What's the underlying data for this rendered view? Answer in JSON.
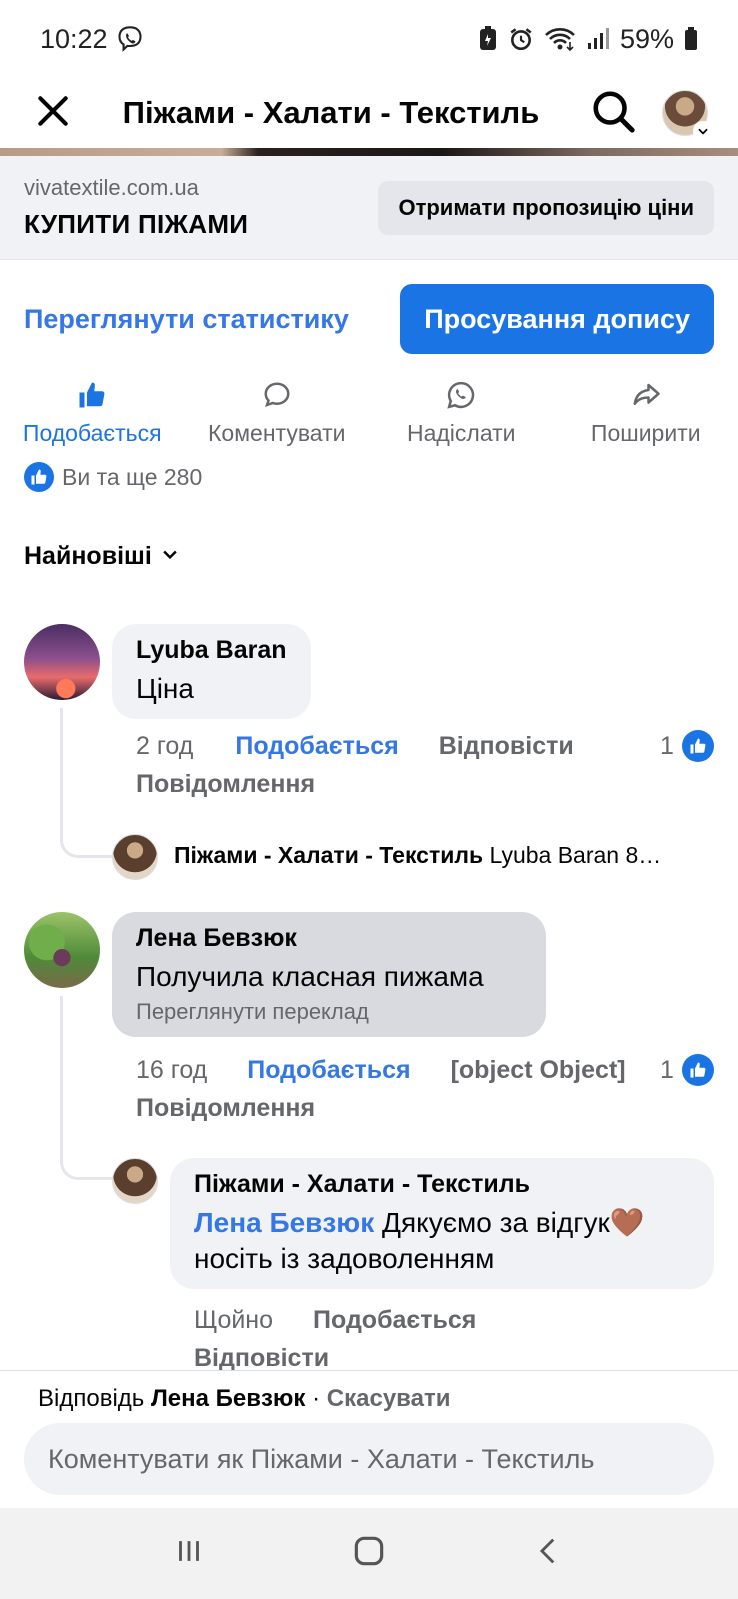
{
  "status_bar": {
    "time": "10:22",
    "battery": "59%"
  },
  "header": {
    "title": "Піжами - Халати - Текстиль"
  },
  "ad": {
    "domain": "vivatextile.com.ua",
    "cta_title": "КУПИТИ ПІЖАМИ",
    "offer_button": "Отримати пропозицію ціни"
  },
  "stats": {
    "view_stats": "Переглянути статистику",
    "promote": "Просування допису"
  },
  "actions": [
    {
      "label": "Подобається",
      "icon": "like-icon",
      "active": true
    },
    {
      "label": "Коментувати",
      "icon": "comment-icon",
      "active": false
    },
    {
      "label": "Надіслати",
      "icon": "whatsapp-icon",
      "active": false
    },
    {
      "label": "Поширити",
      "icon": "share-icon",
      "active": false
    }
  ],
  "reactions": {
    "summary": "Ви та ще 280"
  },
  "sort": {
    "label": "Найновіші"
  },
  "comments": [
    {
      "author": "Lyuba Baran",
      "text": "Ціна",
      "time": "2 год",
      "like": "Подобається",
      "reply": "Відповісти",
      "message": "Повідомлення",
      "reaction_count": "1",
      "reply_preview": {
        "author": "Піжами - Халати - Текстиль",
        "text": "Lyuba Baran 8…"
      }
    },
    {
      "author": "Лена Бевзюк",
      "text": "Получила класная пижама",
      "see_translation": "Переглянути переклад",
      "time": "16 год",
      "like": "Подобається",
      "reply": {
        "author": "Піжами - Халати - Текстиль",
        "mention": "Лена Бевзюк",
        "text_line1": " Дякуємо за відгук🤎",
        "text_line2": "носіть із задоволенням",
        "time": "Щойно",
        "like": "Подобається",
        "reply": "Відповісти"
      },
      "message": "Повідомлення",
      "reaction_count": "1"
    }
  ],
  "composer": {
    "reply_prefix": "Відповідь",
    "reply_name": "Лена Бевзюк",
    "separator": " · ",
    "cancel": "Скасувати",
    "placeholder": "Коментувати як Піжами - Халати - Текстиль"
  }
}
